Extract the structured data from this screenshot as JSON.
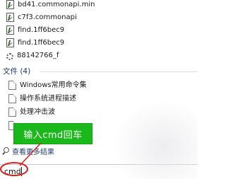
{
  "programs": [
    {
      "label": "bd41.commonapi.min",
      "icon": "script-file-icon"
    },
    {
      "label": "c7f3.commonapi",
      "icon": "script-file-icon"
    },
    {
      "label": "find.1ff6bec9",
      "icon": "script-file-icon"
    },
    {
      "label": "find.1ff6bec9",
      "icon": "script-file-icon"
    },
    {
      "label": "88142766_f",
      "icon": "gear-icon"
    }
  ],
  "files_section": {
    "header": "文件 (4)",
    "items": [
      {
        "label": "Windows常用命令集"
      },
      {
        "label": "操作系统进程描述"
      },
      {
        "label": "处理冲击波"
      },
      {
        "label": ""
      }
    ]
  },
  "see_more": "查看更多结果",
  "search": {
    "value": "cmd"
  },
  "annotation": {
    "text": "输入cmd回车",
    "bg_color": "#1ab81a",
    "circle_color": "#d62020"
  }
}
